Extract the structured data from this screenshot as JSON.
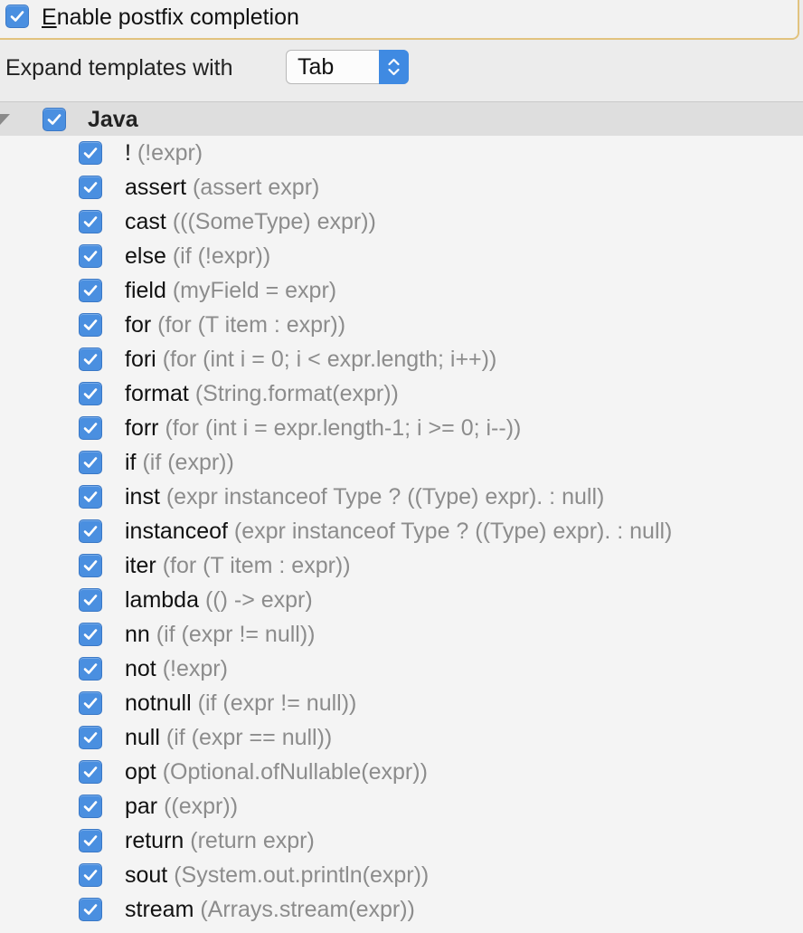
{
  "enable": {
    "label_first": "E",
    "label_rest": "nable postfix completion",
    "checked": true
  },
  "expand": {
    "label": "Expand templates with",
    "selected": "Tab"
  },
  "group": {
    "label": "Java",
    "checked": true
  },
  "items": [
    {
      "key": "!",
      "desc": "(!expr)"
    },
    {
      "key": "assert",
      "desc": "(assert expr)"
    },
    {
      "key": "cast",
      "desc": "(((SomeType) expr))"
    },
    {
      "key": "else",
      "desc": "(if (!expr))"
    },
    {
      "key": "field",
      "desc": "(myField = expr)"
    },
    {
      "key": "for",
      "desc": "(for (T item : expr))"
    },
    {
      "key": "fori",
      "desc": "(for (int i = 0; i < expr.length; i++))"
    },
    {
      "key": "format",
      "desc": "(String.format(expr))"
    },
    {
      "key": "forr",
      "desc": "(for (int i = expr.length-1; i >= 0; i--))"
    },
    {
      "key": "if",
      "desc": "(if (expr))"
    },
    {
      "key": "inst",
      "desc": "(expr instanceof Type ? ((Type) expr). : null)"
    },
    {
      "key": "instanceof",
      "desc": "(expr instanceof Type ? ((Type) expr). : null)"
    },
    {
      "key": "iter",
      "desc": "(for (T item : expr))"
    },
    {
      "key": "lambda",
      "desc": "(() -> expr)"
    },
    {
      "key": "nn",
      "desc": "(if (expr != null))"
    },
    {
      "key": "not",
      "desc": "(!expr)"
    },
    {
      "key": "notnull",
      "desc": "(if (expr != null))"
    },
    {
      "key": "null",
      "desc": "(if (expr == null))"
    },
    {
      "key": "opt",
      "desc": "(Optional.ofNullable(expr))"
    },
    {
      "key": "par",
      "desc": "((expr))"
    },
    {
      "key": "return",
      "desc": "(return expr)"
    },
    {
      "key": "sout",
      "desc": "(System.out.println(expr))"
    },
    {
      "key": "stream",
      "desc": "(Arrays.stream(expr))"
    }
  ],
  "colors": {
    "accent": "#4a8fe0",
    "description": "#8c8c8c",
    "focus_ring": "#e2c37f"
  },
  "icons": {
    "checkbox": "checkmark-icon",
    "select": "updown-arrows-icon",
    "tree": "expand-triangle-icon"
  }
}
